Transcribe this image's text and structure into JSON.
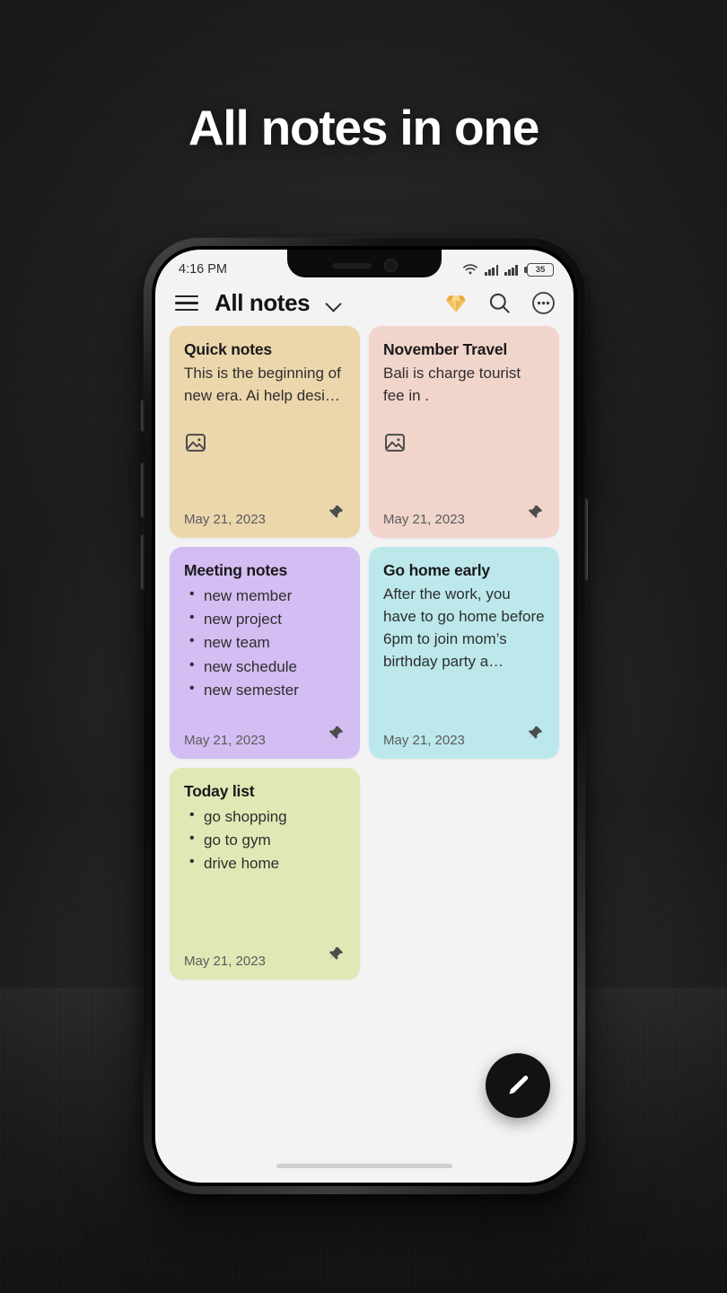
{
  "promo": {
    "headline": "All notes in one"
  },
  "status_bar": {
    "time": "4:16 PM",
    "battery_level": "35",
    "wifi_icon": "wifi-icon",
    "signal_icon_1": "cellular-signal-icon",
    "signal_icon_2": "cellular-signal-icon",
    "battery_icon": "battery-icon"
  },
  "app_bar": {
    "menu_icon": "hamburger-menu-icon",
    "title": "All notes",
    "dropdown_icon": "chevron-down-icon",
    "premium_icon": "diamond-icon",
    "search_icon": "search-icon",
    "more_icon": "more-options-icon"
  },
  "notes": [
    {
      "title": "Quick notes",
      "body": "This is the beginning of new era. Ai help desi…",
      "items": [],
      "date": "May 21, 2023",
      "color": "#ecd7ad",
      "has_image": true,
      "pinned": true,
      "image_icon": "image-attachment-icon",
      "pin_icon": "pin-icon"
    },
    {
      "title": "November Travel",
      "body": "Bali is charge tourist fee in .",
      "items": [],
      "date": "May 21, 2023",
      "color": "#f1d5cb",
      "has_image": true,
      "pinned": true,
      "image_icon": "image-attachment-icon",
      "pin_icon": "pin-icon"
    },
    {
      "title": "Meeting notes",
      "body": "",
      "items": [
        "new member",
        "new project",
        "new team",
        "new schedule",
        "new semester"
      ],
      "date": "May 21, 2023",
      "color": "#d3bdf2",
      "has_image": false,
      "pinned": true,
      "image_icon": "",
      "pin_icon": "pin-icon"
    },
    {
      "title": "Go home early",
      "body": "After the work, you have to go home before 6pm to join mom’s birthday party a…",
      "items": [],
      "date": "May 21, 2023",
      "color": "#bce8ec",
      "has_image": false,
      "pinned": true,
      "image_icon": "",
      "pin_icon": "pin-icon"
    },
    {
      "title": "Today list",
      "body": "",
      "items": [
        "go shopping",
        "go to gym",
        "drive home"
      ],
      "date": "May 21, 2023",
      "color": "#dfe9b5",
      "has_image": false,
      "pinned": true,
      "image_icon": "",
      "pin_icon": "pin-icon"
    }
  ],
  "fab": {
    "icon": "edit-pencil-icon",
    "label": ""
  },
  "colors": {
    "accent_premium": "#e8a93a",
    "fab_background": "#121212",
    "screen_background": "#f3f3f3",
    "text_primary": "#1a1a1a",
    "text_secondary": "#5b5b5b",
    "headline_color": "#ffffff"
  }
}
